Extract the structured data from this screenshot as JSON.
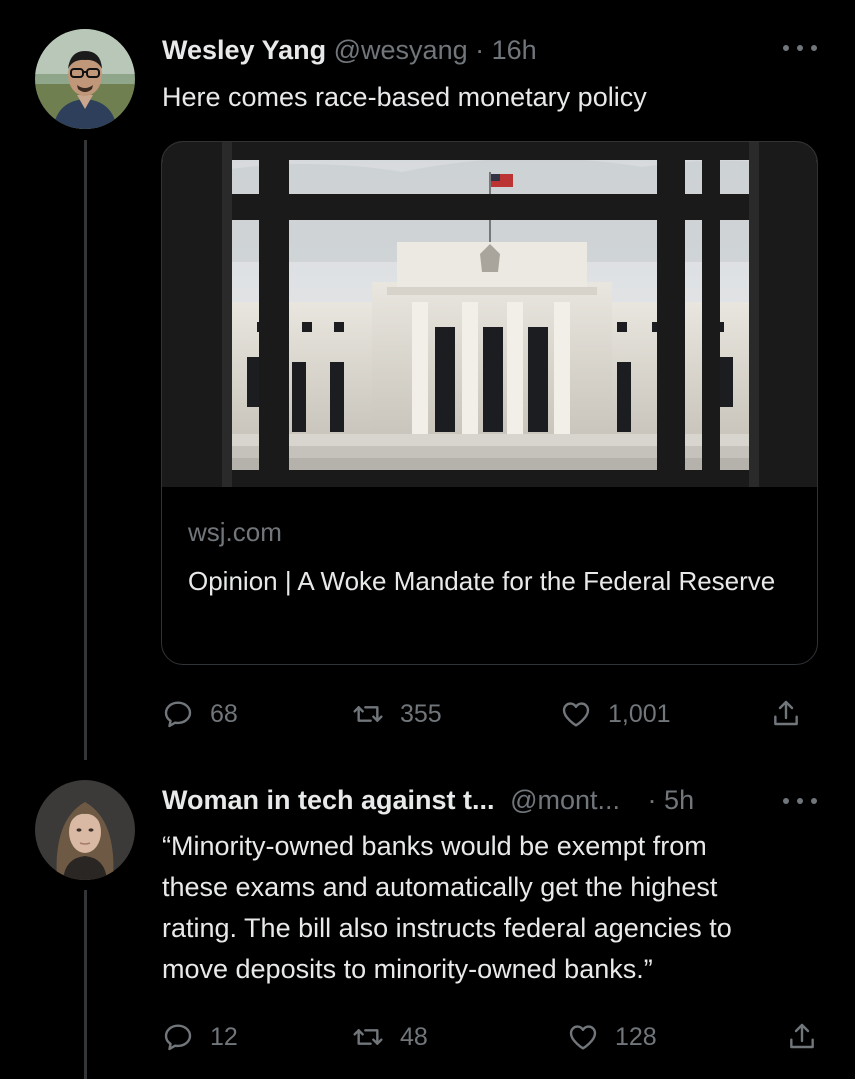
{
  "tweets": [
    {
      "name": "Wesley Yang",
      "handle": "@wesyang",
      "separator": "·",
      "time": "16h",
      "text": "Here comes race-based monetary policy",
      "card": {
        "image_alt": "Federal Reserve building seen through an iron fence",
        "domain": "wsj.com",
        "title": "Opinion | A Woke Mandate for the Federal Reserve"
      },
      "replies": "68",
      "retweets": "355",
      "likes": "1,001"
    },
    {
      "name": "Woman in tech against t...",
      "handle": "@mont...",
      "separator": "·",
      "time": "5h",
      "text_lines": [
        "“Minority-owned banks would be exempt from",
        "these exams and automatically get the highest",
        "rating. The bill also instructs federal agencies to",
        "move deposits to minority-owned banks.”"
      ],
      "replies": "12",
      "retweets": "48",
      "likes": "128"
    }
  ],
  "icons": {
    "more": "more-icon",
    "reply": "reply-icon",
    "retweet": "retweet-icon",
    "like": "heart-icon",
    "share": "share-icon"
  },
  "colors": {
    "background": "#000000",
    "text": "#e7e9ea",
    "secondary": "#71767b",
    "border": "#2f3336"
  }
}
